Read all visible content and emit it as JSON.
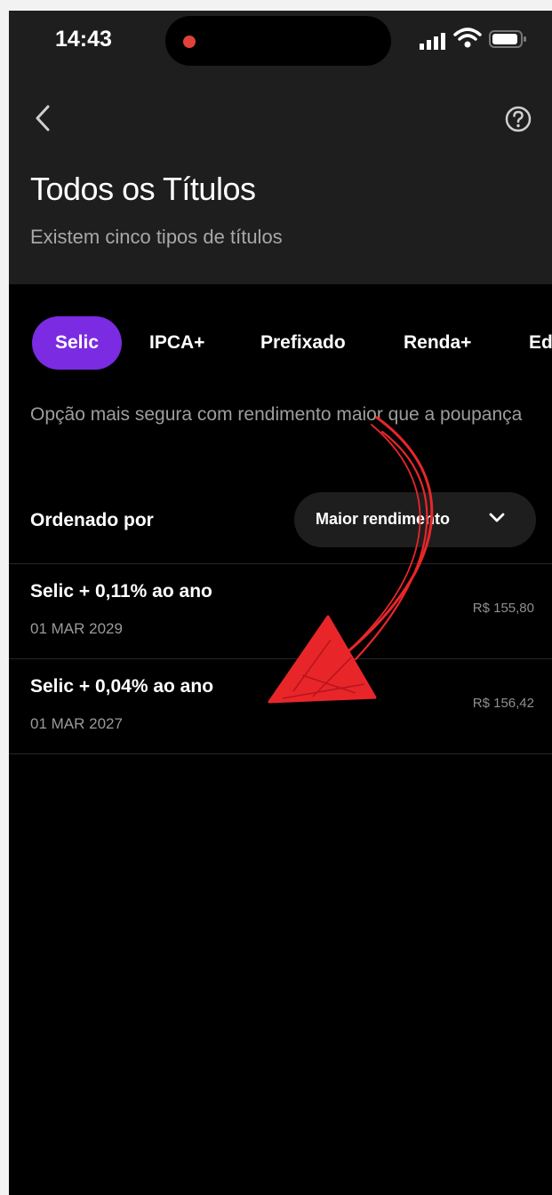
{
  "status_bar": {
    "time": "14:43"
  },
  "header": {
    "title": "Todos os Títulos",
    "subtitle": "Existem cinco tipos de títulos"
  },
  "tabs": [
    {
      "label": "Selic",
      "active": true
    },
    {
      "label": "IPCA+",
      "active": false
    },
    {
      "label": "Prefixado",
      "active": false
    },
    {
      "label": "Renda+",
      "active": false
    },
    {
      "label": "Ed",
      "active": false
    }
  ],
  "description": "Opção mais segura com rendimento maior que a poupança",
  "sort": {
    "label": "Ordenado por",
    "selected": "Maior rendimento"
  },
  "titles": [
    {
      "name": "Selic + 0,11% ao ano",
      "maturity": "01 MAR 2029",
      "price": "R$ 155,80"
    },
    {
      "name": "Selic + 0,04% ao ano",
      "maturity": "01 MAR 2027",
      "price": "R$ 156,42"
    }
  ],
  "colors": {
    "accent": "#7b2be2",
    "annotation": "#e8262a",
    "background": "#000000",
    "header_bg": "#1e1e1e"
  },
  "icons": {
    "back": "chevron-left-icon",
    "help": "question-circle-icon",
    "sort": "chevron-down-icon"
  }
}
